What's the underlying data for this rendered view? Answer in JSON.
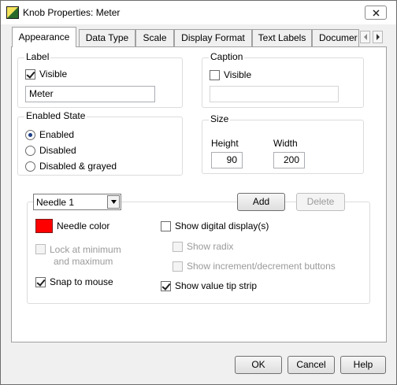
{
  "window": {
    "title": "Knob Properties: Meter"
  },
  "tabs": [
    {
      "label": "Appearance",
      "active": true
    },
    {
      "label": "Data Type",
      "active": false
    },
    {
      "label": "Scale",
      "active": false
    },
    {
      "label": "Display Format",
      "active": false
    },
    {
      "label": "Text Labels",
      "active": false
    },
    {
      "label": "Documer",
      "active": false
    }
  ],
  "label_group": {
    "title": "Label",
    "visible_label": "Visible",
    "visible_checked": true,
    "value": "Meter"
  },
  "caption_group": {
    "title": "Caption",
    "visible_label": "Visible",
    "visible_checked": false,
    "value": ""
  },
  "enabled_state": {
    "title": "Enabled State",
    "options": [
      "Enabled",
      "Disabled",
      "Disabled & grayed"
    ],
    "selected": "Enabled"
  },
  "size_group": {
    "title": "Size",
    "height_label": "Height",
    "height_value": "90",
    "width_label": "Width",
    "width_value": "200"
  },
  "needle": {
    "selector_value": "Needle 1",
    "add_label": "Add",
    "delete_label": "Delete",
    "color_label": "Needle color",
    "color_hex": "#ff0000",
    "lock_label_line1": "Lock at minimum",
    "lock_label_line2": "and maximum",
    "lock_checked": false,
    "snap_label": "Snap to mouse",
    "snap_checked": true,
    "digital_label": "Show digital display(s)",
    "digital_checked": false,
    "radix_label": "Show radix",
    "incdec_label": "Show increment/decrement buttons",
    "tipstrip_label": "Show value tip strip",
    "tipstrip_checked": true
  },
  "footer": {
    "ok_label": "OK",
    "cancel_label": "Cancel",
    "help_label": "Help"
  }
}
